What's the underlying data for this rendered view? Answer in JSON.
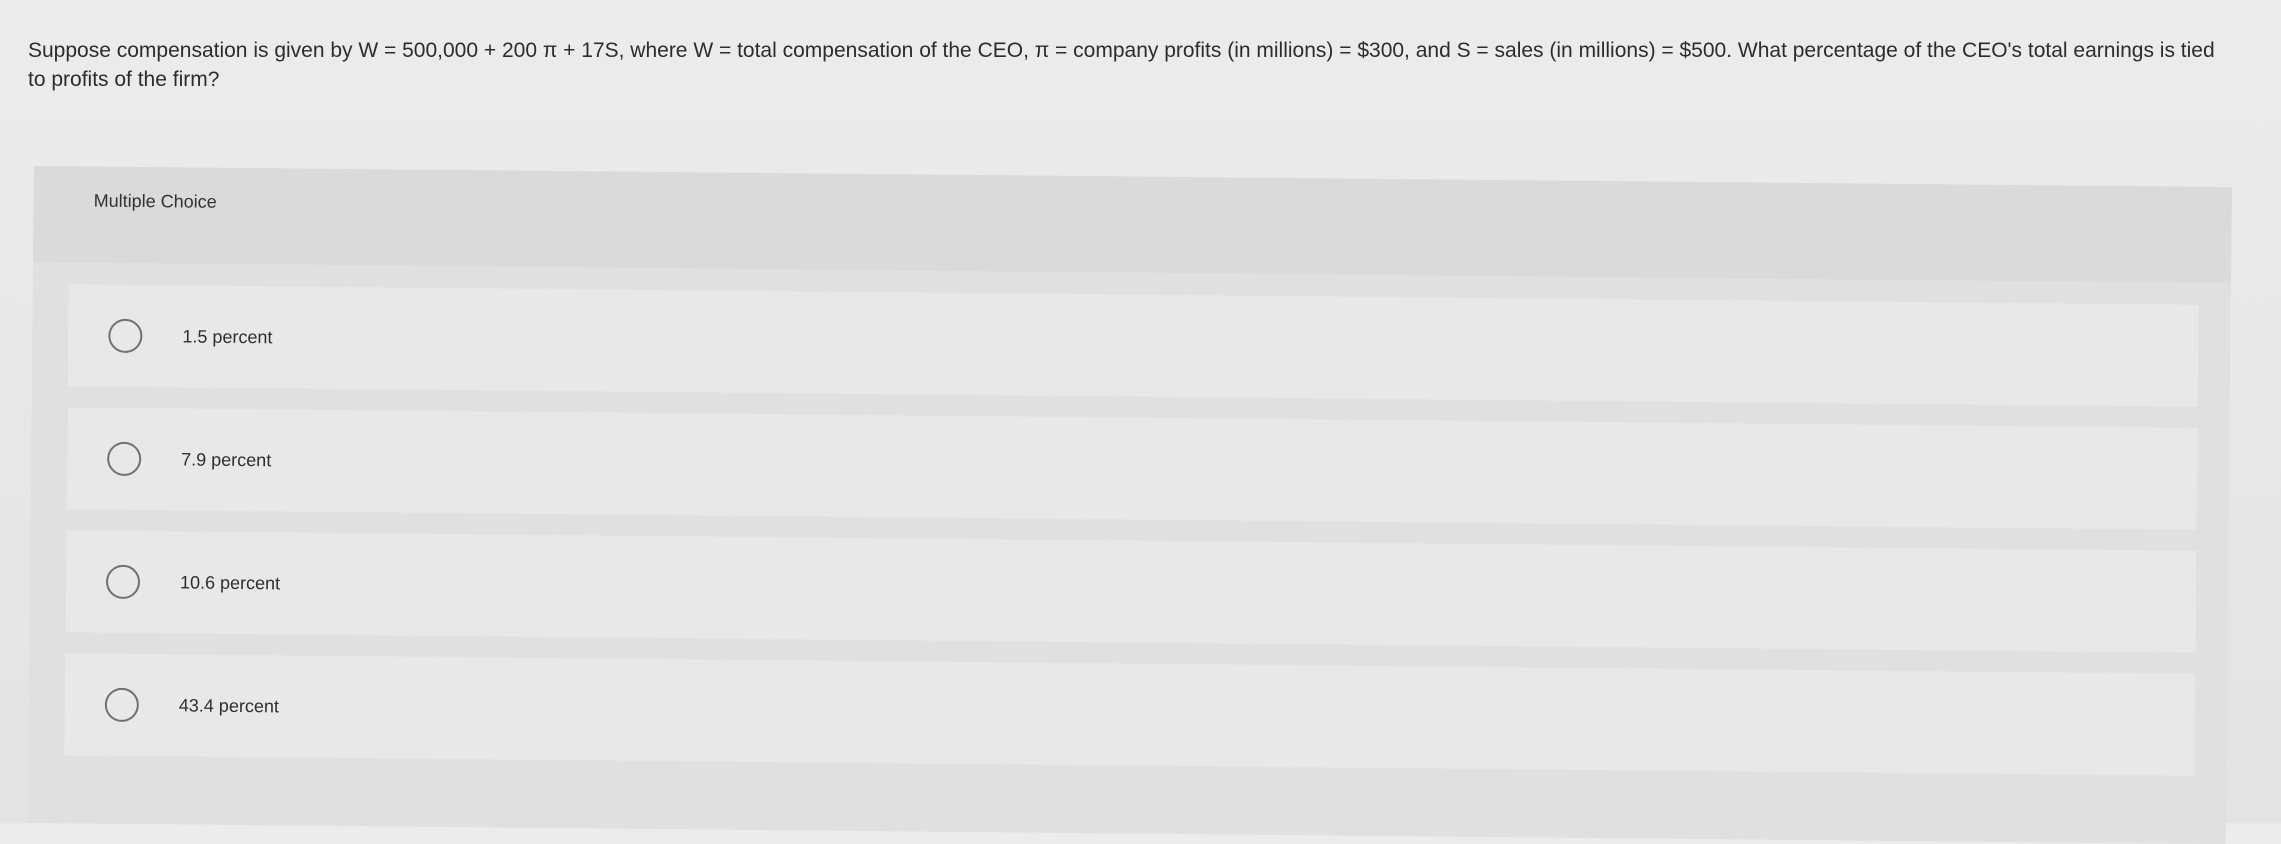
{
  "question": {
    "text": "Suppose compensation is given by W = 500,000 + 200 π + 17S, where W = total compensation of the CEO, π = company profits (in millions) = $300, and S = sales (in millions) = $500. What percentage of the CEO's total earnings is tied to profits of the firm?"
  },
  "multiple_choice": {
    "label": "Multiple Choice",
    "options": [
      {
        "label": "1.5 percent",
        "selected": false
      },
      {
        "label": "7.9 percent",
        "selected": false
      },
      {
        "label": "10.6 percent",
        "selected": false
      },
      {
        "label": "43.4 percent",
        "selected": false
      }
    ]
  }
}
